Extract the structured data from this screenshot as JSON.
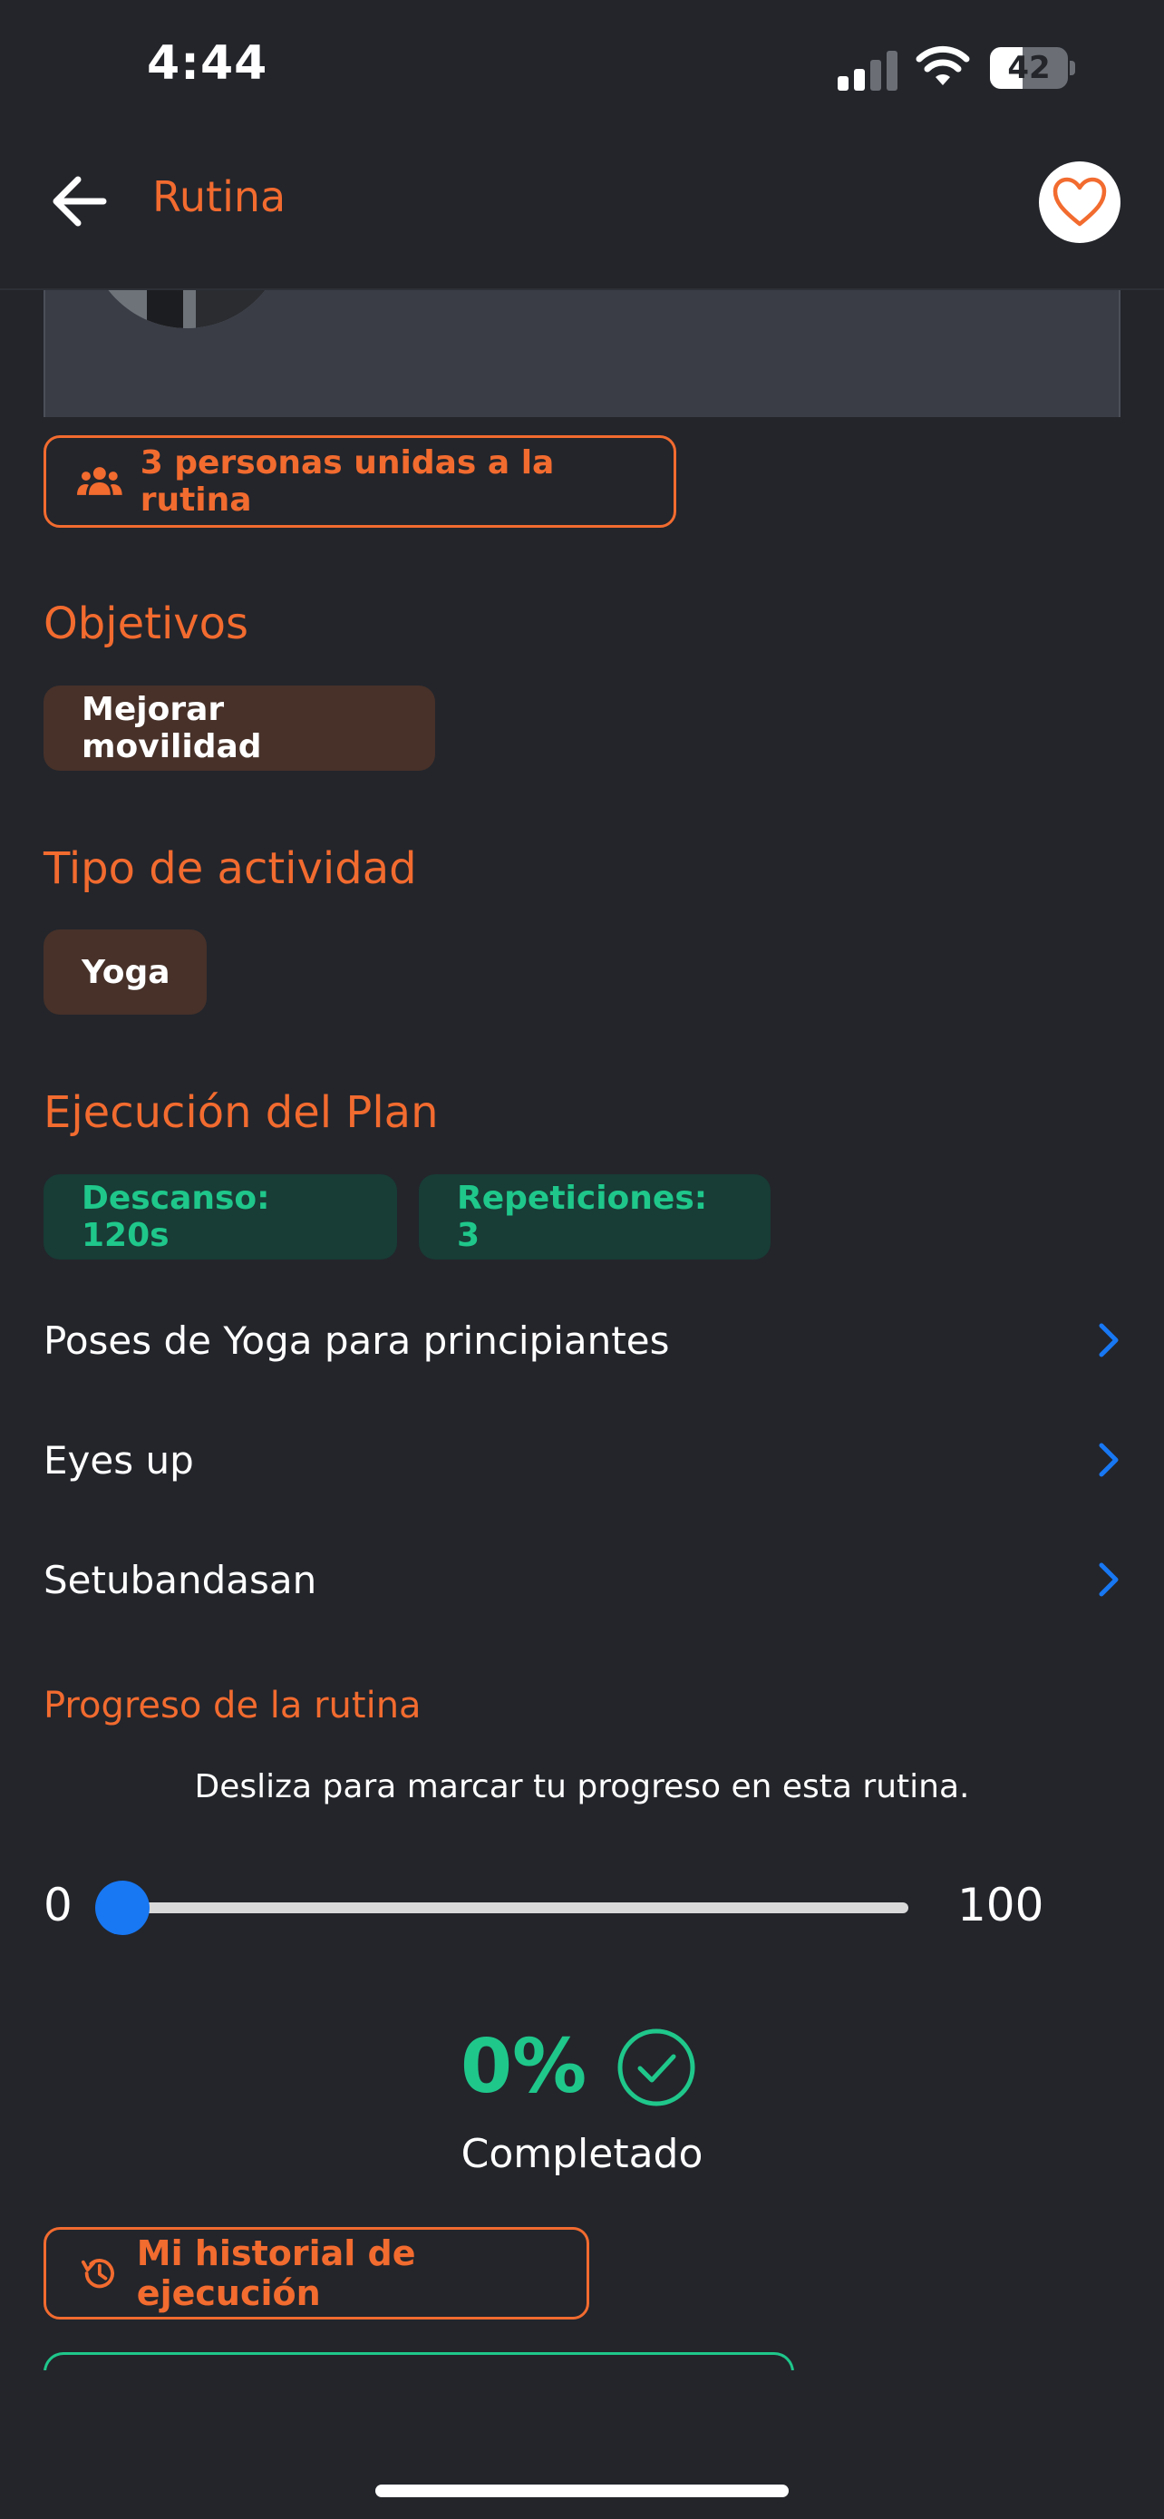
{
  "status_bar": {
    "time": "4:44",
    "battery": "42"
  },
  "nav": {
    "title": "Rutina"
  },
  "trainer": {
    "rating_stars": "★★★★★"
  },
  "joined": {
    "label": "3 personas unidas a la rutina"
  },
  "objectives": {
    "title": "Objetivos",
    "chips": [
      "Mejorar movilidad"
    ]
  },
  "activity": {
    "title": "Tipo de actividad",
    "chips": [
      "Yoga"
    ]
  },
  "execution": {
    "title": "Ejecución del Plan",
    "rest_label": "Descanso: 120s",
    "reps_label": "Repeticiones: 3",
    "exercises": [
      "Poses de Yoga para principiantes",
      "Eyes up",
      "Setubandasan"
    ]
  },
  "progress": {
    "title": "Progreso de la rutina",
    "hint": "Desliza para marcar tu progreso en esta rutina.",
    "slider_min": "0",
    "slider_max": "100",
    "value": 0,
    "percent_label": "0%",
    "completed_label": "Completado"
  },
  "history_button": {
    "label": "Mi historial de ejecución"
  },
  "colors": {
    "background": "#23252b",
    "accent": "#f26b2f",
    "success": "#1fc78b",
    "chevron": "#1877f2",
    "star": "#f5a623"
  }
}
